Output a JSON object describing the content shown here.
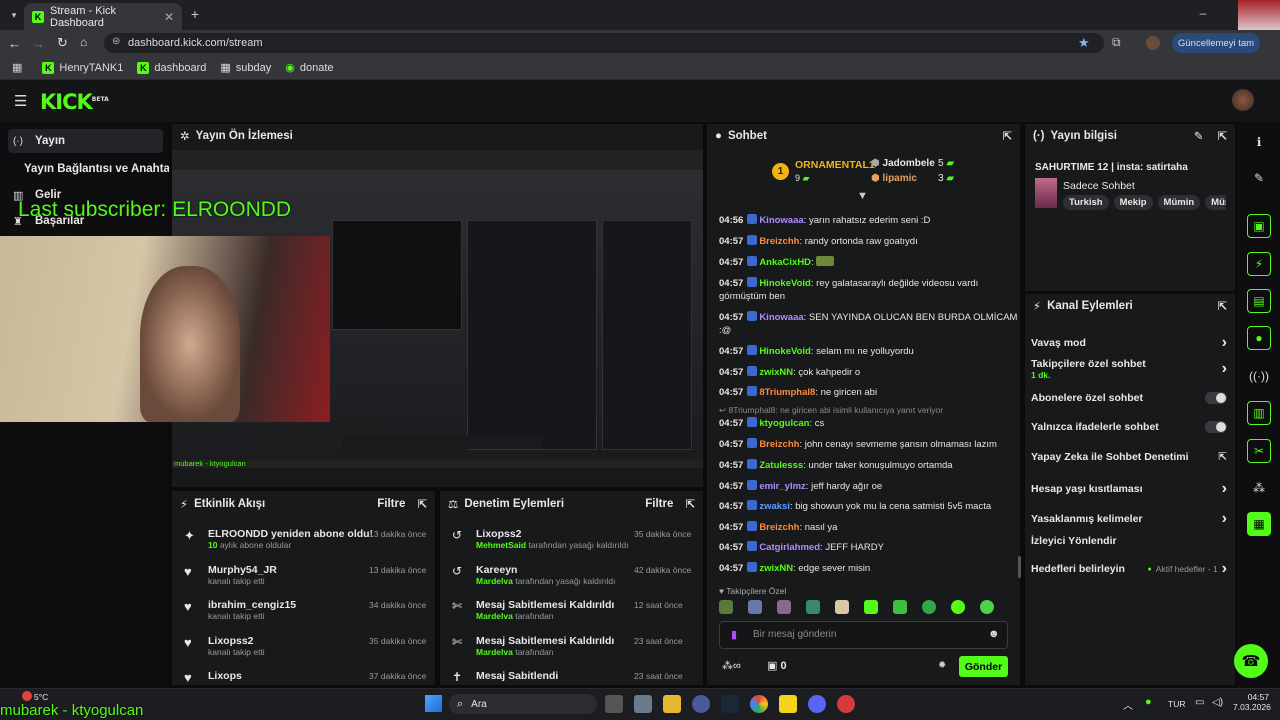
{
  "browser": {
    "tab_title": "Stream - Kick Dashboard",
    "url": "dashboard.kick.com/stream",
    "update_label": "Güncellemeyi tam",
    "bookmarks": [
      "HenryTANK1",
      "dashboard",
      "subday",
      "donate"
    ]
  },
  "logo": {
    "text": "KICK",
    "beta": "BETA"
  },
  "sidebar": {
    "items": [
      "Yayın",
      "Yayın Bağlantısı ve Anahtarı",
      "Gelir",
      "Başarılar"
    ]
  },
  "overlay": {
    "last_sub": "Last subscriber: ELROONDD",
    "bottom_name": "mubarek - ktyogulcan",
    "preview_name": "mubarek - ktyogulcan"
  },
  "preview": {
    "title": "Yayın Ön İzlemesi"
  },
  "activity": {
    "title": "Etkinlik Akışı",
    "filter": "Filtre",
    "items": [
      {
        "title": "ELROONDD yeniden abone oldu!",
        "detail_green": "10",
        "detail": " aylık abone oldular",
        "time": "13 dakika önce"
      },
      {
        "title": "Murphy54_JR",
        "detail_green": "",
        "detail": "kanalı takip etti",
        "time": "13 dakika önce"
      },
      {
        "title": "ibrahim_cengiz15",
        "detail_green": "",
        "detail": "kanalı takip etti",
        "time": "34 dakika önce"
      },
      {
        "title": "Lixopss2",
        "detail_green": "",
        "detail": "kanalı takip etti",
        "time": "35 dakika önce"
      },
      {
        "title": "Lixops",
        "detail_green": "",
        "detail": "",
        "time": "37 dakika önce"
      }
    ]
  },
  "moderation": {
    "title": "Denetim Eylemleri",
    "filter": "Filtre",
    "items": [
      {
        "title": "Lixopss2",
        "by": "MehmetSaid",
        "detail": " tarafından yasağı kaldırıldı",
        "time": "35 dakika önce"
      },
      {
        "title": "Kareeyn",
        "by": "Mardelva",
        "detail": " tarafından yasağı kaldırıldı",
        "time": "42 dakika önce"
      },
      {
        "title": "Mesaj Sabitlemesi Kaldırıldı",
        "by": "Mardelva",
        "detail": " tarafından",
        "time": "12 saat önce"
      },
      {
        "title": "Mesaj Sabitlemesi Kaldırıldı",
        "by": "Mardelva",
        "detail": " tarafından",
        "time": "23 saat önce"
      },
      {
        "title": "Mesaj Sabitlendi",
        "by": "",
        "detail": "",
        "time": "23 saat önce"
      }
    ]
  },
  "chat": {
    "title": "Sohbet",
    "top": [
      {
        "rank": "1",
        "name": "ORNAMENTAL1",
        "count": "9"
      },
      {
        "name": "Jadombele",
        "count": "5"
      },
      {
        "name": "lipamic",
        "count": "3"
      }
    ],
    "messages": [
      {
        "time": "04:56",
        "user": "Kinowaaa",
        "color": "#b18cff",
        "text": "yarın rahatsız ederim seni :D"
      },
      {
        "time": "04:57",
        "user": "Breizchh",
        "color": "#ff8a3d",
        "text": "randy ortonda raw goatıydı"
      },
      {
        "time": "04:57",
        "user": "AnkaCixHD",
        "color": "#53fc18",
        "text": ""
      },
      {
        "time": "04:57",
        "user": "HinokeVoid",
        "color": "#53fc18",
        "text": "rey galatasaraylı değilde videosu vardı görmüştüm ben"
      },
      {
        "time": "04:57",
        "user": "Kinowaaa",
        "color": "#b18cff",
        "text": "SEN YAYINDA OLUCAN BEN BURDA OLMİCAM :@"
      },
      {
        "time": "04:57",
        "user": "HinokeVoid",
        "color": "#53fc18",
        "text": "selam mı ne yolluyordu"
      },
      {
        "time": "04:57",
        "user": "zwixNN",
        "color": "#53fc18",
        "text": "çok kahpedir o"
      },
      {
        "time": "04:57",
        "user": "8Triumphal8",
        "color": "#ff8a3d",
        "text": "ne giricen abi"
      },
      {
        "time": "04:57",
        "user": "ktyogulcan",
        "color": "#53fc18",
        "text": "cs"
      },
      {
        "time": "04:57",
        "user": "Breizchh",
        "color": "#ff8a3d",
        "text": "john cenayı sevmeme şansın olmaması lazım"
      },
      {
        "time": "04:57",
        "user": "Zatulesss",
        "color": "#53fc18",
        "text": "under taker konuşulmuyo ortamda"
      },
      {
        "time": "04:57",
        "user": "emir_ylmz",
        "color": "#b18cff",
        "text": "jeff hardy ağır oe"
      },
      {
        "time": "04:57",
        "user": "zwaksi",
        "color": "#5aa0ff",
        "text": "big showun yok mu la cena satmisti 5v5 macta"
      },
      {
        "time": "04:57",
        "user": "Breizchh",
        "color": "#ff8a3d",
        "text": "nasıl ya"
      },
      {
        "time": "04:57",
        "user": "Catgirlahmed",
        "color": "#b18cff",
        "text": "JEFF HARDY"
      },
      {
        "time": "04:57",
        "user": "zwixNN",
        "color": "#53fc18",
        "text": "edge sever misin"
      }
    ],
    "reply_note": "8Triumphal8: ne giricen abi isimli kullanıcıya yanıt veriyor",
    "followers_only": "Takipçilere Özel",
    "input_placeholder": "Bir mesaj gönderin",
    "infinity": "∞",
    "points": "0",
    "send": "Gönder"
  },
  "stream_info": {
    "title": "Yayın bilgisi",
    "stream_title": "SAHURTIME 12 | insta: satirtaha",
    "category": "Sadece Sohbet",
    "tags": [
      "Turkish",
      "Mekip",
      "Mümin",
      "Müs"
    ]
  },
  "channel_actions": {
    "title": "Kanal Eylemleri",
    "items": [
      {
        "label": "Vavaş mod",
        "type": "chevron",
        "note": ""
      },
      {
        "label": "Takipçilere özel sohbet",
        "type": "chevron",
        "note": "1 dk."
      },
      {
        "label": "Abonelere özel sohbet",
        "type": "toggle",
        "note": ""
      },
      {
        "label": "Yalnızca ifadelerle sohbet",
        "type": "toggle",
        "note": ""
      },
      {
        "label": "Yapay Zeka ile Sohbet Denetimi",
        "type": "external",
        "note": ""
      },
      {
        "label": "Hesap yaşı kısıtlaması",
        "type": "chevron",
        "note": ""
      },
      {
        "label": "Yasaklanmış kelimeler",
        "type": "chevron",
        "note": ""
      },
      {
        "label": "İzleyici Yönlendir",
        "type": "none",
        "note": ""
      },
      {
        "label": "Hedefleri belirleyin",
        "type": "chevron",
        "note": "Aktif hedefler - 1"
      }
    ]
  },
  "taskbar": {
    "weather": "5°C",
    "search": "Ara",
    "lang": "TUR",
    "clock": "04:57",
    "date": "7.03.2026"
  },
  "colors": {
    "accent": "#53fc18",
    "panel": "#18191b",
    "bg": "#0b0b0c"
  }
}
